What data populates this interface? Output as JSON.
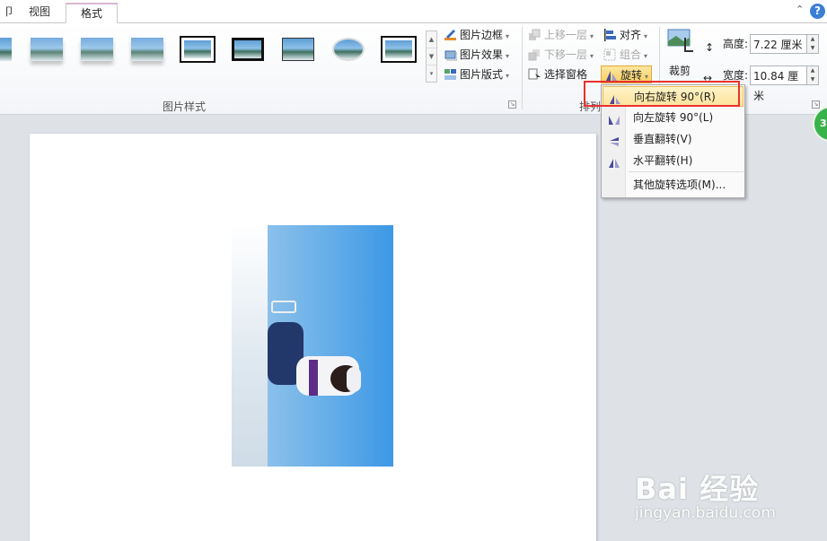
{
  "tabs": {
    "partial": "卩",
    "view": "视图",
    "format": "格式"
  },
  "ribbon": {
    "picture_styles": {
      "label": "图片样式",
      "border": "图片边框",
      "effects": "图片效果",
      "layout": "图片版式"
    },
    "arrange": {
      "label": "排列",
      "bring_forward": "上移一层",
      "send_backward": "下移一层",
      "selection_pane": "选择窗格",
      "align": "对齐",
      "group": "组合",
      "rotate": "旋转"
    },
    "size": {
      "crop": "裁剪",
      "height_label": "高度:",
      "height_value": "7.22 厘米",
      "width_label": "宽度:",
      "width_value": "10.84 厘米"
    }
  },
  "rotate_menu": {
    "items": [
      {
        "label": "向右旋转 90°(R)",
        "icon": "rotate-right-icon",
        "highlighted": true
      },
      {
        "label": "向左旋转 90°(L)",
        "icon": "rotate-left-icon",
        "highlighted": false
      },
      {
        "label": "垂直翻转(V)",
        "icon": "flip-vertical-icon",
        "highlighted": false
      },
      {
        "label": "水平翻转(H)",
        "icon": "flip-horizontal-icon",
        "highlighted": false
      },
      {
        "label": "其他旋转选项(M)...",
        "icon": "",
        "highlighted": false
      }
    ]
  },
  "badge": {
    "text": "3"
  },
  "watermark": {
    "logo": "Bai 经验",
    "url": "jingyan.baidu.com"
  },
  "colors": {
    "highlight_border": "#e8322e",
    "accent": "#f7cf62"
  }
}
